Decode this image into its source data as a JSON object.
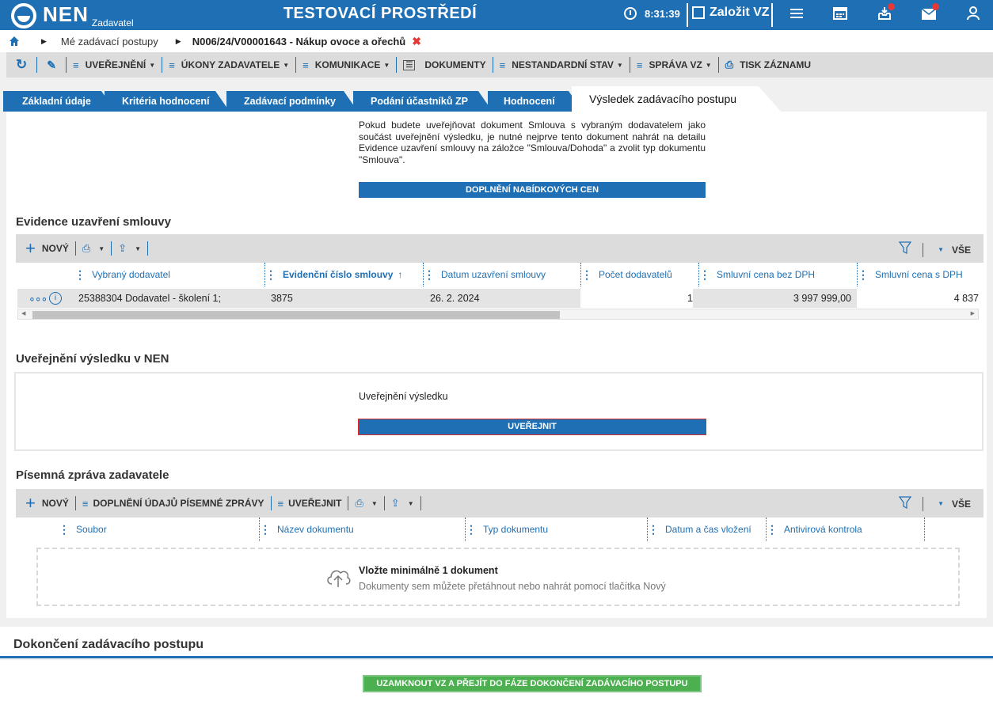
{
  "header": {
    "logo_text": "NEN",
    "logo_sub": "Zadavatel",
    "environment": "TESTOVACÍ PROSTŘEDÍ",
    "time": "8:31:39",
    "new_vz": "Založit VZ"
  },
  "breadcrumb": {
    "item1": "Mé zadávací postupy",
    "item2": "N006/24/V00001643 - Nákup ovoce a ořechů"
  },
  "toolbar": {
    "uverejneni": "UVEŘEJNĚNÍ",
    "ukony": "ÚKONY ZADAVATELE",
    "komunikace": "KOMUNIKACE",
    "dokumenty": "DOKUMENTY",
    "nestandardni": "NESTANDARDNÍ STAV",
    "sprava": "SPRÁVA VZ",
    "tisk": "TISK ZÁZNAMU"
  },
  "tabs": {
    "t1": "Základní údaje",
    "t2": "Kritéria hodnocení",
    "t3": "Zadávací podmínky",
    "t4": "Podání účastníků ZP",
    "t5": "Hodnocení",
    "active": "Výsledek zadávacího postupu"
  },
  "note": "Pokud budete uveřejňovat dokument Smlouva s vybraným dodavatelem jako součást uveřejnění výsledku, je nutné nejprve tento dokument nahrát na detailu Evidence uzavření smlouvy na záložce \"Smlouva/Dohoda\" a zvolit typ dokumentu \"Smlouva\".",
  "doplneni_btn": "DOPLNĚNÍ NABÍDKOVÝCH CEN",
  "evidence": {
    "title": "Evidence uzavření smlouvy",
    "new": "NOVÝ",
    "all": "VŠE",
    "columns": [
      "Vybraný dodavatel",
      "Evidenční číslo smlouvy",
      "Datum uzavření smlouvy",
      "Počet dodavatelů",
      "Smluvní cena bez DPH",
      "Smluvní cena s DPH"
    ],
    "row": {
      "dodavatel": "25388304 Dodavatel - školení 1;",
      "cislo": "3875",
      "datum": "26. 2. 2024",
      "pocet": "1",
      "cena_bez": "3 997 999,00",
      "cena_s": "4 837"
    }
  },
  "publish": {
    "title": "Uveřejnění výsledku v NEN",
    "label": "Uveřejnění výsledku",
    "button": "UVEŘEJNIT"
  },
  "report": {
    "title": "Písemná zpráva zadavatele",
    "new": "NOVÝ",
    "doplneni": "DOPLNĚNÍ ÚDAJŮ PÍSEMNÉ ZPRÁVY",
    "uverejnit": "UVEŘEJNIT",
    "all": "VŠE",
    "columns": [
      "Soubor",
      "Název dokumentu",
      "Typ dokumentu",
      "Datum a čas vložení",
      "Antivirová kontrola"
    ],
    "drop_title": "Vložte minimálně 1 dokument",
    "drop_sub": "Dokumenty sem můžete přetáhnout nebo nahrát pomocí tlačítka Nový"
  },
  "finish": {
    "title": "Dokončení zadávacího postupu",
    "button": "UZAMKNOUT VZ A PŘEJÍT DO FÁZE DOKONČENÍ ZADÁVACÍHO POSTUPU"
  }
}
